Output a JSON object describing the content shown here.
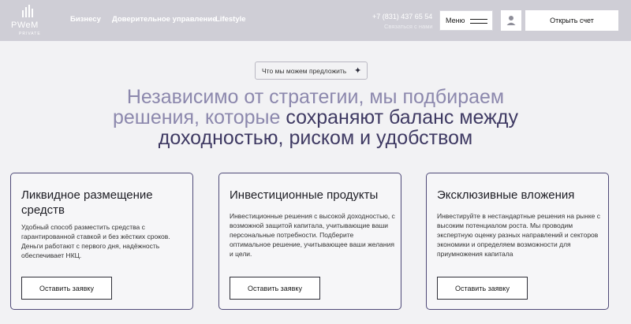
{
  "header": {
    "logo_text": "PWeM",
    "logo_sub": "PRIVATE",
    "nav": [
      "Бизнесу",
      "Доверительное управление",
      "Lifestyle"
    ],
    "phone": "+7 (831) 437 65 54",
    "callback": "Связаться с нами",
    "menu_label": "Меню",
    "open_account": "Открыть счет"
  },
  "hero": {
    "pill_label": "Что мы можем предложить",
    "line1": "Независимо от стратегии, мы подбираем",
    "line2_light": "решения, которые ",
    "line2_strong": "сохраняют баланс между",
    "line3": "доходностью, риском и удобством"
  },
  "cards": [
    {
      "title": "Ликвидное размещение средств",
      "text": "Удобный способ разместить средства с гарантированной ставкой и без жёстких сроков. Деньги работают с первого дня, надёжность обеспечивает НКЦ.",
      "button": "Оставить заявку"
    },
    {
      "title": "Инвестиционные продукты",
      "text": "Инвестиционные решения с высокой доходностью, с возможной защитой капитала, учитывающие ваши персональные потребности. Подберите оптимальное решение, учитывающее ваши желания и цели.",
      "button": "Оставить заявку"
    },
    {
      "title": "Эксклюзивные вложения",
      "text": "Инвестируйте в нестандартные решения на рынке с высоким потенциалом роста. Мы проводим экспертную оценку разных направлений и секторов экономики и определяем возможности для приумножения капитала",
      "button": "Оставить заявку"
    }
  ]
}
